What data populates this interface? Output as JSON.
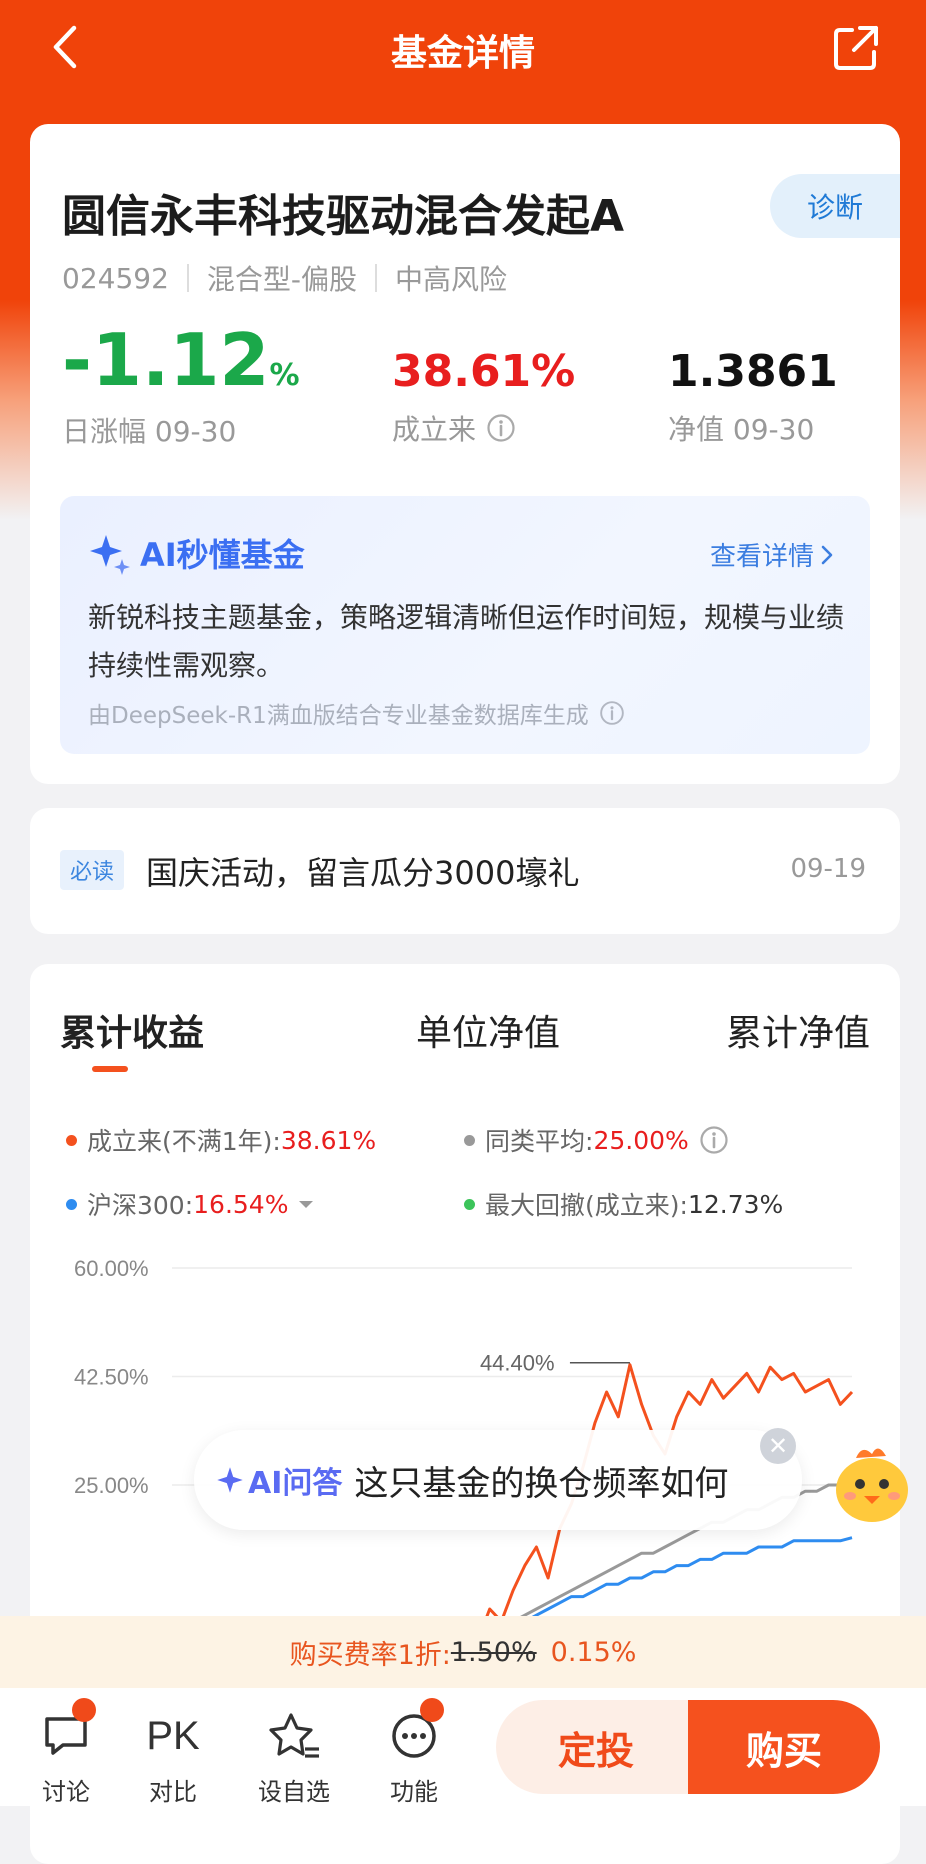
{
  "header": {
    "title": "基金详情"
  },
  "fund": {
    "name": "圆信永丰科技驱动混合发起A",
    "diagnose_label": "诊断",
    "code": "024592",
    "type": "混合型-偏股",
    "risk": "中高风险",
    "daily_change": "-1.12",
    "daily_change_unit": "%",
    "daily_change_label": "日涨幅 09-30",
    "since_inception": "38.61%",
    "since_inception_label": "成立来",
    "nav": "1.3861",
    "nav_label": "净值 09-30"
  },
  "ai_summary": {
    "title": "AI秒懂基金",
    "more": "查看详情",
    "text": "新锐科技主题基金，策略逻辑清晰但运作时间短，规模与业绩持续性需观察。",
    "footer": "由DeepSeek-R1满血版结合专业基金数据库生成"
  },
  "notice": {
    "badge": "必读",
    "text": "国庆活动，留言瓜分3000壕礼",
    "date": "09-19"
  },
  "chart_tabs": [
    "累计收益",
    "单位净值",
    "累计净值"
  ],
  "legend": {
    "fund": {
      "label": "成立来(不满1年):",
      "value": "38.61%",
      "color": "#f4511e"
    },
    "peer": {
      "label": "同类平均:",
      "value": "25.00%",
      "color": "#999999"
    },
    "index": {
      "label": "沪深300:",
      "value": "16.54%",
      "color": "#2e8cf0"
    },
    "drawdown": {
      "label": "最大回撤(成立来):",
      "value": "12.73%",
      "color": "#3cc45a"
    }
  },
  "chart_data": {
    "type": "line",
    "yticks": [
      "60.00%",
      "42.50%",
      "25.00%"
    ],
    "ylim": [
      0,
      60
    ],
    "annotation": "44.40%",
    "series": [
      {
        "name": "成立来",
        "color": "#f4511e",
        "values": [
          0,
          5,
          3,
          8,
          12,
          15,
          10,
          18,
          22,
          28,
          35,
          40,
          36,
          44.4,
          38,
          33,
          30,
          36,
          40,
          38,
          42,
          39,
          41,
          43,
          40,
          44,
          42,
          43,
          40,
          41,
          42,
          38,
          40
        ]
      },
      {
        "name": "同类平均",
        "color": "#999999",
        "values": [
          0,
          1,
          2,
          3,
          4,
          5,
          6,
          7,
          8,
          9,
          10,
          11,
          12,
          13,
          14,
          14,
          15,
          16,
          17,
          18,
          19,
          19,
          20,
          21,
          21,
          22,
          23,
          23,
          24,
          24,
          25,
          25,
          25
        ]
      },
      {
        "name": "沪深300",
        "color": "#2e8cf0",
        "values": [
          0,
          1,
          2,
          2,
          3,
          4,
          5,
          6,
          7,
          7,
          8,
          9,
          9,
          10,
          10,
          11,
          11,
          12,
          12,
          13,
          13,
          14,
          14,
          14,
          15,
          15,
          15,
          16,
          16,
          16,
          16,
          16,
          16.5
        ]
      }
    ]
  },
  "ai_float": {
    "label": "AI问答",
    "question": "这只基金的换仓频率如何",
    "close": "✕"
  },
  "fee": {
    "label": "购买费率1折:",
    "original": "1.50%",
    "discounted": "0.15%"
  },
  "bottom_nav": {
    "discuss": "讨论",
    "pk_icon": "PK",
    "compare": "对比",
    "watchlist": "设自选",
    "functions": "功能",
    "sip": "定投",
    "buy": "购买"
  },
  "icons": {
    "back": "chevron-left-icon",
    "share": "share-icon",
    "info": "info-icon",
    "sparkle": "sparkle-icon"
  }
}
